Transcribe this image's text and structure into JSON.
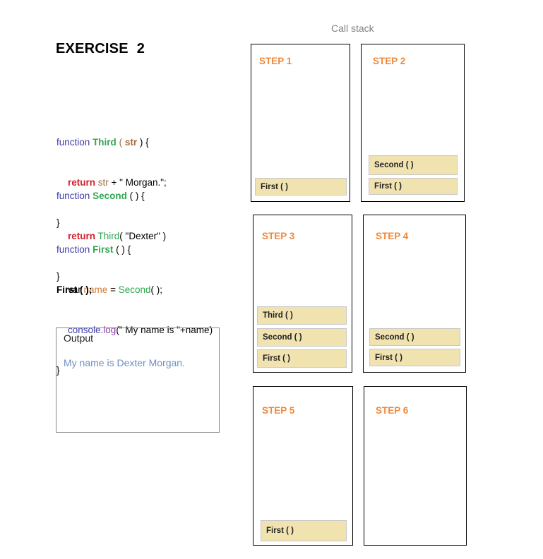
{
  "title": {
    "word": "EXERCISE",
    "number": "2"
  },
  "call_stack_label": "Call stack",
  "code": {
    "third": {
      "kw": "function",
      "name": "Third",
      "open": " ( ",
      "param": "str",
      "close": " ) {",
      "ret": "return",
      "body_var": "str",
      "body_rest": " + \" Morgan.\";",
      "end": "}"
    },
    "second": {
      "kw": "function",
      "name": "Second",
      "sig": " ( ) {",
      "ret": "return",
      "call": "Third",
      "args": "( \"Dexter\" )",
      "end": "}"
    },
    "first": {
      "kw": "function",
      "name": "First",
      "sig": " ( ) {",
      "var_kw": "var",
      "var_name": "name",
      "eq": " = ",
      "call": "Second",
      "call_rest": "( );",
      "console": "console.",
      "log": "log",
      "log_args": "(\" My name is \"+name)",
      "end": "}"
    },
    "invoke": "First ( );"
  },
  "output": {
    "title": "Output",
    "text": "My name is Dexter Morgan."
  },
  "steps": [
    {
      "label": "STEP 1",
      "frames": [
        "First ( )"
      ]
    },
    {
      "label": "STEP 2",
      "frames": [
        "Second ( )",
        "First ( )"
      ]
    },
    {
      "label": "STEP 3",
      "frames": [
        "Third ( )",
        "Second ( )",
        "First ( )"
      ]
    },
    {
      "label": "STEP 4",
      "frames": [
        "Second ( )",
        "First ( )"
      ]
    },
    {
      "label": "STEP 5",
      "frames": [
        "First ( )"
      ]
    },
    {
      "label": "STEP 6",
      "frames": []
    }
  ],
  "colors": {
    "step_label": "#f0883a",
    "frame_fill": "#f1e3b0",
    "output_text": "#6f8fbf",
    "keyword_function": "#3b3ba8",
    "function_name": "#2fa84f",
    "return_keyword": "#d0202e"
  }
}
